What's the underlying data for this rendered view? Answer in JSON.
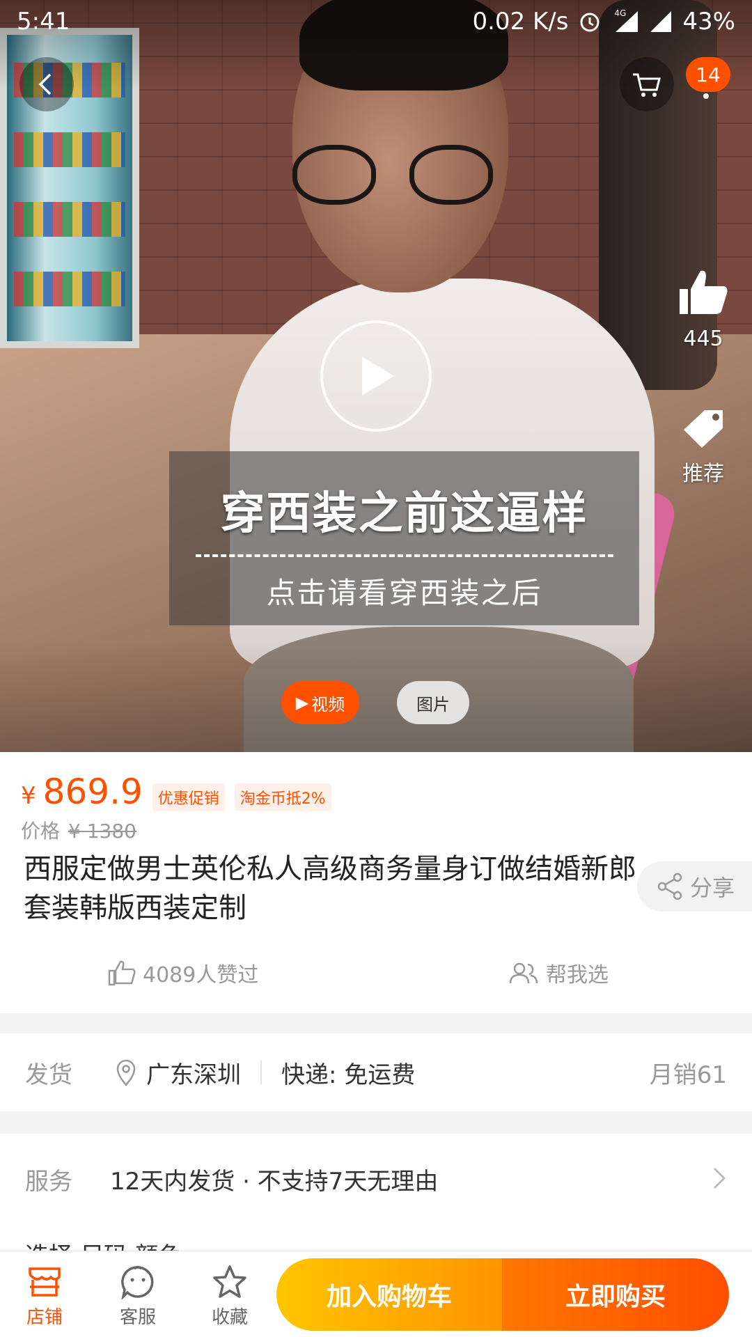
{
  "status_bar": {
    "time": "5:41",
    "network_speed": "0.02 K/s",
    "network_type": "4G",
    "battery": "43%"
  },
  "top_bar": {
    "cart_badge": "14"
  },
  "media": {
    "caption_line1": "穿西装之前这逼样",
    "caption_line2": "点击请看穿西装之后",
    "tab_video": "视频",
    "tab_photo": "图片",
    "like_count": "445",
    "recommend_label": "推荐"
  },
  "product": {
    "currency": "¥",
    "price": "869.9",
    "promo_tag_1": "优惠促销",
    "promo_tag_2": "淘金币抵2%",
    "original_price_label": "价格",
    "original_price": "¥ 1380",
    "title": "西服定做男士英伦私人高级商务量身订做结婚新郎套装韩版西装定制",
    "share_label": "分享",
    "likes_text": "4089人赞过",
    "help_choose": "帮我选"
  },
  "shipping": {
    "label": "发货",
    "location": "广东深圳",
    "express": "快递: 免运费",
    "monthly_sales": "月销61"
  },
  "service": {
    "label": "服务",
    "value": "12天内发货 · 不支持7天无理由",
    "next_row_peek": "选择 尺码 颜色"
  },
  "bottom_bar": {
    "store": "店铺",
    "customer_service": "客服",
    "favorite": "收藏",
    "add_to_cart": "加入购物车",
    "buy_now": "立即购买"
  },
  "colors": {
    "accent": "#ff5000",
    "cart_button": "#ffa000",
    "buy_button": "#ff5a00"
  },
  "icons": [
    "back-icon",
    "cart-icon",
    "thumbs-up-icon",
    "tag-icon",
    "play-icon",
    "share-icon",
    "location-pin-icon",
    "people-icon",
    "chevron-right-icon",
    "store-icon",
    "chat-face-icon",
    "star-icon"
  ]
}
